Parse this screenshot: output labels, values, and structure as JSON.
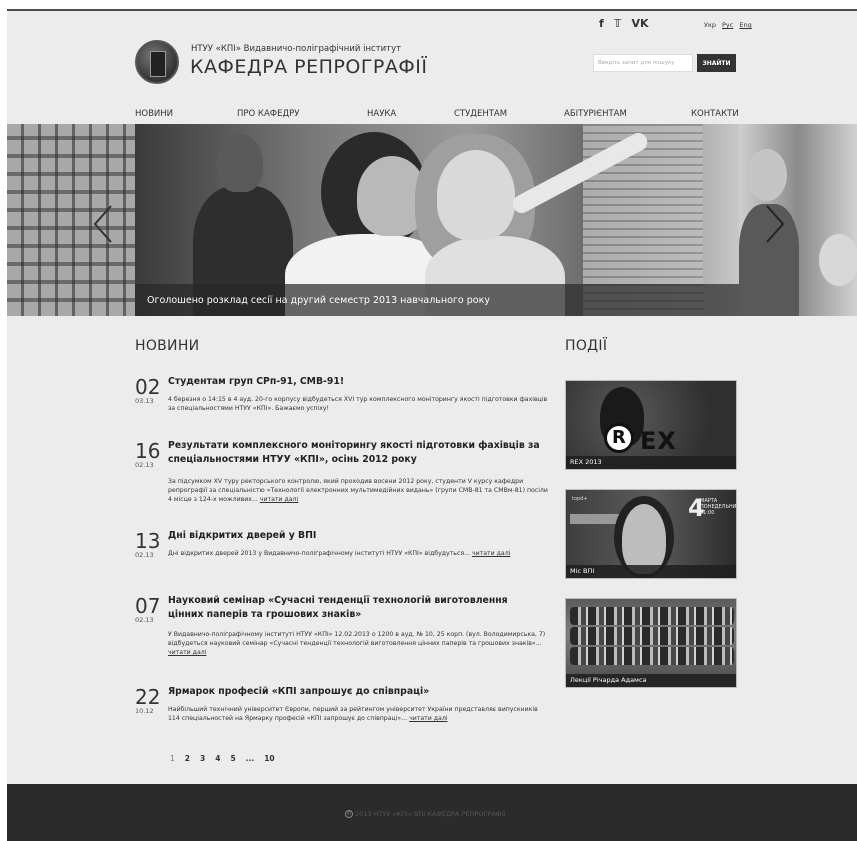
{
  "header": {
    "institute_line": "НТУУ «КПІ» Видавничо-поліграфічний інститут",
    "department_title": "КАФЕДРА РЕПРОГРАФІЇ",
    "socials": [
      "f",
      "🐦",
      "VK"
    ],
    "languages": [
      "Укр",
      "Рус",
      "Eng"
    ],
    "search_placeholder": "Введіть запит для пошуку",
    "search_button": "ЗНАЙТИ"
  },
  "nav": {
    "items": [
      "НОВИНИ",
      "ПРО  КАФЕДРУ",
      "НАУКА",
      "СТУДЕНТАМ",
      "АБІТУРІЄНТАМ",
      "КОНТАКТИ"
    ]
  },
  "slider": {
    "caption": "Оголошено розклад сесії на другий семестр 2013 навчального року"
  },
  "news": {
    "title": "НОВИНИ",
    "items": [
      {
        "day": "02",
        "date": "03.13",
        "title": "Студентам груп СРп-91, СМВ-91!",
        "text": "4 березня о 14:15 в 4 ауд. 20-го корпусу відбудеться XVI тур комплексного моніторингу якості підготовки фахівців за спеціальностями НТУУ «КПІ». Бажаємо успіху!",
        "more": ""
      },
      {
        "day": "16",
        "date": "02.13",
        "title": "Результати комплексного моніторингу якості підготовки фахівців за спеціальностями НТУУ «КПІ», осінь 2012 року",
        "text": "За підсумком XV туру ректорського контролю, який проходив восени 2012 року, студенти V курсу кафедри репрографії за спеціальністю «Технології електронних мультимедійних видань» (групи СМВ-81 та СМВм-81) посіли 4 місце з 124-х можливих...",
        "more": "читати далі"
      },
      {
        "day": "13",
        "date": "02.13",
        "title": "Дні відкритих дверей у ВПІ",
        "text": "Дні відкритих дверей 2013 у Видавничо-поліграфічному інституті НТУУ «КПІ» відбудуться...",
        "more": "читати далі"
      },
      {
        "day": "07",
        "date": "02.13",
        "title": "Науковий семінар «Сучасні тенденції технологій виготовлення цінних паперів та грошових знаків»",
        "text": "У Видавничо-поліграфічному інституті НТУУ «КПІ» 12.02.2013 о 1200 в ауд. № 10, 25 корп. (вул. Володимирська, 7) відбудеться науковий семінар «Сучасні тенденції технологій виготовлення цінних паперів та грошових знаків»...",
        "more": "читати далі"
      },
      {
        "day": "22",
        "date": "10.12",
        "title": "Ярмарок професій «КПІ запрошує до співпраці»",
        "text": "Найбільший технічний університет Європи, перший за рейтингом університет України представляє випускників 114 спеціальностей на Ярмарку професій «КПІ запрошує до співпраці»...",
        "more": "читати далі"
      }
    ]
  },
  "pager": [
    "1",
    "2",
    "3",
    "4",
    "5",
    "...",
    "10"
  ],
  "events": {
    "title": "ПОДІЇ",
    "items": [
      {
        "label": "REX 2013",
        "image_text": "EX",
        "image_letter": "R"
      },
      {
        "label": "Міс ВПІ",
        "image_text": "4",
        "image_small": "МАРТА\nПОНЕДЕЛЬНИК\n21:00",
        "image_logo": "topd+"
      },
      {
        "label": "Лекції Річарда Адамса"
      }
    ]
  },
  "footer": {
    "text": "2013 НТУУ «КПІ» ВПІ КАФЕДРА РЕПРОГРАФІЇ"
  }
}
